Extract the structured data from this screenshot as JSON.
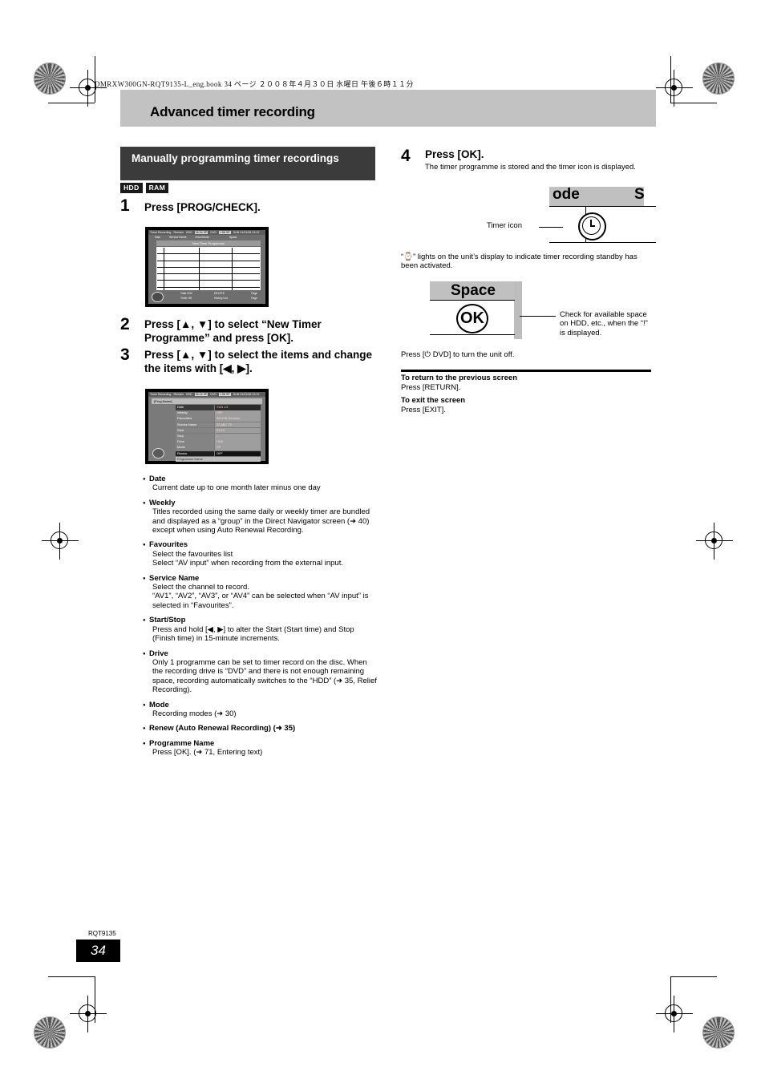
{
  "meta": {
    "book_line": "DMRXW300GN-RQT9135-L_eng.book   34 ページ   ２００８年４月３０日   水曜日   午後６時１１分",
    "footer_code": "RQT9135",
    "page_number": "34"
  },
  "chapter": {
    "title": "Advanced timer recording"
  },
  "section": {
    "heading": "Manually programming timer recordings",
    "badges": [
      "HDD",
      "RAM"
    ]
  },
  "steps": [
    {
      "num": "1",
      "text": "Press [PROG/CHECK]."
    },
    {
      "num": "2",
      "text": "Press [▲, ▼] to select “New Timer Programme” and press [OK]."
    },
    {
      "num": "3",
      "text": "Press [▲, ▼] to select the items and change the items with [◀, ▶]."
    },
    {
      "num": "4",
      "text": "Press [OK].",
      "sub": "The timer programme is stored and the timer icon is displayed."
    }
  ],
  "screen_timer_list": {
    "title": "Timer Recording",
    "remain_label": "Remain",
    "hdd_label": "HDD",
    "hdd_value": "36:34 SP",
    "dvd_label": "DVD",
    "dvd_value": "1:58 SP",
    "datetime": "SUN 01/01/08 13:12",
    "columns": [
      "Date",
      "Service Name",
      "Drive/Mode",
      "Space"
    ],
    "new_entry": "New Timer Programme",
    "total_label": "Total 0/32",
    "timer_off_label": "Timer Off",
    "delete_label": "DELETE",
    "history_label": "History List",
    "page_up_label": "Page",
    "page_down_label": "Page"
  },
  "screen_prog_name": {
    "title": "Timer Recording",
    "remain_label": "Remain",
    "hdd_label": "HDD",
    "hdd_value": "36:24 SP",
    "dvd_label": "DVD",
    "dvd_value": "1:58 SP",
    "datetime": "SUN 01/01/08 13:12",
    "prog_name_tab": "[Prog.Name]",
    "rows": [
      {
        "label": "Date",
        "value": "SUN 1/1"
      },
      {
        "label": "Weekly",
        "value": "OFF"
      },
      {
        "label": "Favourites",
        "value": "All DVB Services"
      },
      {
        "label": "Service Name",
        "value": "22 ABC TV"
      },
      {
        "label": "Start",
        "value": "01:10"
      },
      {
        "label": "Stop",
        "value": "--"
      },
      {
        "label": "Drive",
        "value": "HDD"
      },
      {
        "label": "Mode",
        "value": "SP"
      },
      {
        "label": "Renew",
        "value": "OFF"
      }
    ],
    "programme_name_row": "Programme Name"
  },
  "items": [
    {
      "term": "Date",
      "lines": [
        "Current date up to one month later minus one day"
      ]
    },
    {
      "term": "Weekly",
      "lines": [
        "Titles recorded using the same daily or weekly timer are bundled and displayed as a “group” in the Direct Navigator screen (➜ 40) except when using Auto Renewal Recording."
      ]
    },
    {
      "term": "Favourites",
      "lines": [
        "Select the favourites list",
        "Select “AV input” when recording from the external input."
      ]
    },
    {
      "term": "Service Name",
      "lines": [
        "Select the channel to record.",
        "“AV1”, “AV2”, “AV3”, or “AV4” can be selected when “AV input” is selected in “Favourites”."
      ]
    },
    {
      "term": "Start/Stop",
      "lines": [
        "Press and hold [◀, ▶] to alter the Start (Start time) and Stop (Finish time) in 15-minute increments."
      ]
    },
    {
      "term": "Drive",
      "lines": [
        "Only 1 programme can be set to timer record on the disc. When the recording drive is “DVD” and there is not enough remaining space, recording automatically switches to the “HDD” (➜ 35, Relief Recording)."
      ]
    },
    {
      "term": "Mode",
      "lines": [
        "Recording modes (➜ 30)"
      ]
    },
    {
      "term": "Renew (Auto Renewal Recording) (➜ 35)",
      "lines": []
    },
    {
      "term": "Programme Name",
      "lines": [
        "Press [OK]. (➜ 71, Entering text)"
      ]
    }
  ],
  "panels": {
    "timer_icon_panel": {
      "header_left": "ode",
      "header_right": "S",
      "callout": "Timer icon",
      "icon_name": "clock-icon"
    },
    "timer_note": "“⌚” lights on the unit’s display to indicate timer recording standby has been activated.",
    "space_panel": {
      "header": "Space",
      "ok_label": "OK",
      "callout": "Check for available space on HDD, etc., when the “!” is displayed."
    },
    "power_off_note": "Press [⏻ DVD] to turn the unit off."
  },
  "return_block": {
    "return_title": "To return to the previous screen",
    "return_text": "Press [RETURN].",
    "exit_title": "To exit the screen",
    "exit_text": "Press [EXIT]."
  }
}
